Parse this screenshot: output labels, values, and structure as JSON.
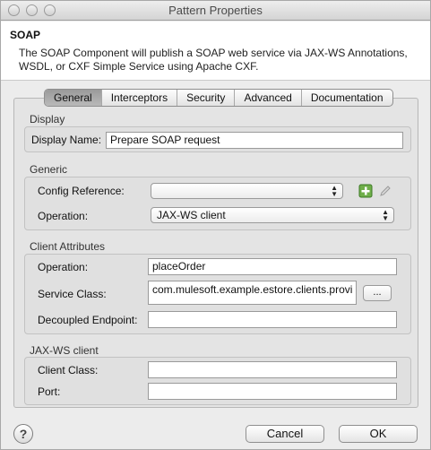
{
  "window": {
    "title": "Pattern Properties"
  },
  "header": {
    "title": "SOAP",
    "description": "The SOAP Component will publish a SOAP web service via JAX-WS Annotations, WSDL, or CXF Simple Service using Apache CXF."
  },
  "tabs": [
    {
      "label": "General",
      "active": true
    },
    {
      "label": "Interceptors"
    },
    {
      "label": "Security"
    },
    {
      "label": "Advanced"
    },
    {
      "label": "Documentation"
    }
  ],
  "display": {
    "section": "Display",
    "name_label": "Display Name:",
    "name_value": "Prepare SOAP request"
  },
  "generic": {
    "section": "Generic",
    "config_label": "Config Reference:",
    "config_value": "",
    "operation_label": "Operation:",
    "operation_value": "JAX-WS client"
  },
  "client_attributes": {
    "section": "Client Attributes",
    "operation_label": "Operation:",
    "operation_value": "placeOrder",
    "service_class_label": "Service Class:",
    "service_class_value": "com.mulesoft.example.estore.clients.provi",
    "browse_label": "...",
    "decoupled_label": "Decoupled Endpoint:",
    "decoupled_value": ""
  },
  "jaxws_client": {
    "section": "JAX-WS client",
    "client_class_label": "Client Class:",
    "client_class_value": "",
    "port_label": "Port:",
    "port_value": ""
  },
  "footer": {
    "help": "?",
    "cancel": "Cancel",
    "ok": "OK"
  }
}
